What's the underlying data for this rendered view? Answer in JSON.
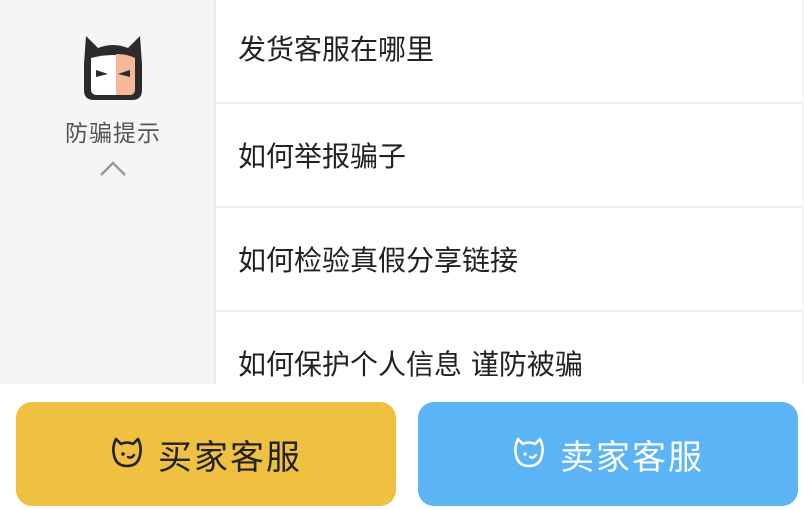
{
  "sidebar": {
    "tab_label": "防骗提示",
    "mascot_icon": "devil-face-icon",
    "collapse_icon": "chevron-up-icon"
  },
  "faq": {
    "items": [
      "发货客服在哪里",
      "如何举报骗子",
      "如何检验真假分享链接",
      "如何保护个人信息 谨防被骗"
    ]
  },
  "bottom": {
    "buyer_label": "买家客服",
    "seller_label": "卖家客服",
    "buyer_icon": "smile-chat-icon",
    "seller_icon": "smile-chat-icon"
  },
  "colors": {
    "buyer_button": "#f0c040",
    "seller_button": "#5ab4f5",
    "mascot_accent": "#f5b99a"
  }
}
